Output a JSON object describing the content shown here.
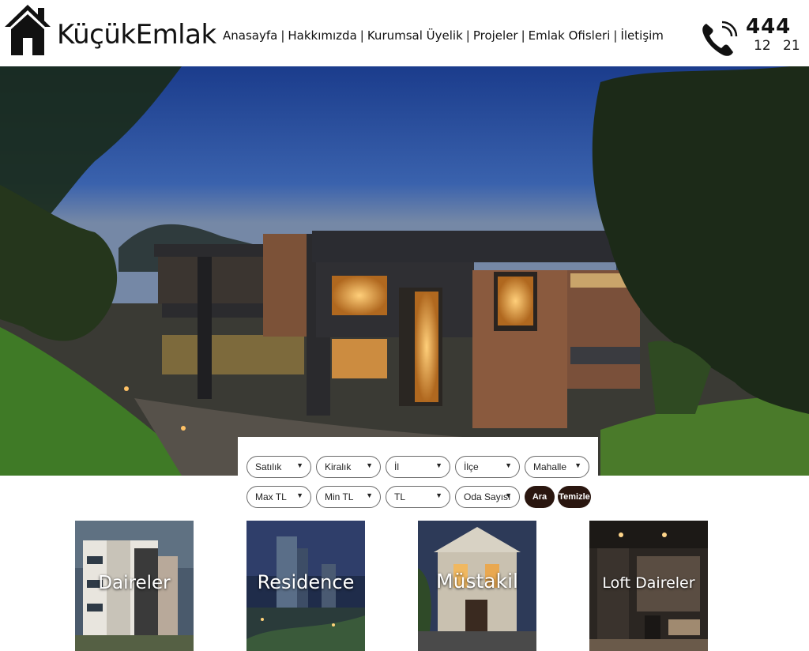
{
  "brand": {
    "name": "KüçükEmlak"
  },
  "nav": {
    "items": [
      "Anasayfa",
      "Hakkımızda",
      "Kurumsal Üyelik",
      "Projeler",
      "Emlak Ofisleri",
      "İletişim"
    ],
    "separator": "|"
  },
  "contact": {
    "phone_main": "444",
    "phone_sub": "12 21"
  },
  "search": {
    "row1": [
      {
        "label": "Satılık",
        "arrow": "▼"
      },
      {
        "label": "Kiralık",
        "arrow": "▼"
      },
      {
        "label": "İl",
        "arrow": "▼"
      },
      {
        "label": "İlçe",
        "arrow": "▼"
      },
      {
        "label": "Mahalle",
        "arrow": "▼"
      }
    ],
    "row2": [
      {
        "label": "Max TL",
        "arrow": "▼"
      },
      {
        "label": "Min TL",
        "arrow": "▼"
      },
      {
        "label": "TL",
        "arrow": "▼"
      },
      {
        "label": "Oda Sayısı",
        "arrow": "▼"
      }
    ],
    "search_button": "Ara",
    "clear_button": "Temizle"
  },
  "categories": [
    {
      "label": "Daireler"
    },
    {
      "label": "Residence"
    },
    {
      "label": "Müstakil"
    },
    {
      "label": "Loft Daireler"
    }
  ],
  "icons": {
    "logo": "house-icon",
    "phone": "phone-icon",
    "dropdown": "chevron-down-icon"
  },
  "colors": {
    "button_dark": "#2a160f",
    "text": "#111111"
  }
}
